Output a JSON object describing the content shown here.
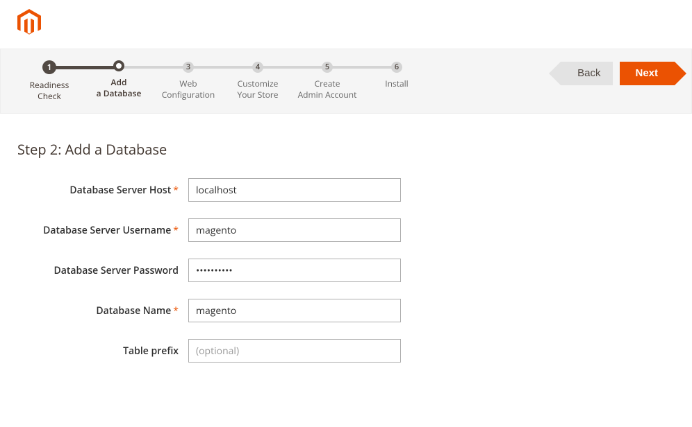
{
  "colors": {
    "accent": "#eb5202",
    "dark": "#514943"
  },
  "steps": [
    {
      "num": "1",
      "label1": "Readiness",
      "label2": "Check",
      "state": "done"
    },
    {
      "num": "2",
      "label1": "Add",
      "label2": "a Database",
      "state": "active"
    },
    {
      "num": "3",
      "label1": "Web",
      "label2": "Configuration",
      "state": "todo"
    },
    {
      "num": "4",
      "label1": "Customize",
      "label2": "Your Store",
      "state": "todo"
    },
    {
      "num": "5",
      "label1": "Create",
      "label2": "Admin Account",
      "state": "todo"
    },
    {
      "num": "6",
      "label1": "Install",
      "label2": "",
      "state": "todo"
    }
  ],
  "nav": {
    "back": "Back",
    "next": "Next"
  },
  "title": "Step 2: Add a Database",
  "fields": {
    "db_host": {
      "label": "Database Server Host",
      "required": true,
      "value": "localhost",
      "placeholder": ""
    },
    "db_user": {
      "label": "Database Server Username",
      "required": true,
      "value": "magento",
      "placeholder": ""
    },
    "db_pass": {
      "label": "Database Server Password",
      "required": false,
      "value": "••••••••••",
      "placeholder": ""
    },
    "db_name": {
      "label": "Database Name",
      "required": true,
      "value": "magento",
      "placeholder": ""
    },
    "table_prefix": {
      "label": "Table prefix",
      "required": false,
      "value": "",
      "placeholder": "(optional)"
    }
  }
}
